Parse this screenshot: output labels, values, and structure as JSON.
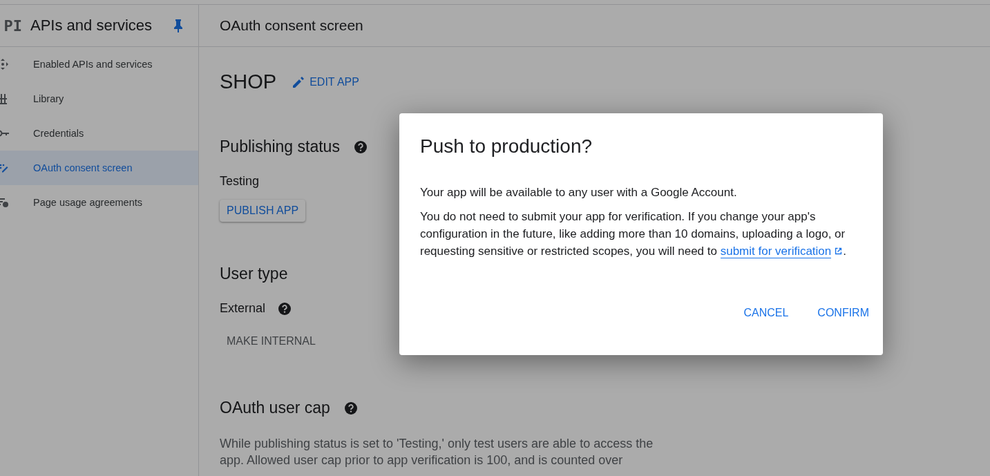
{
  "sidebar": {
    "logo": "PI",
    "title": "APIs and services",
    "items": [
      {
        "label": "Enabled APIs and services",
        "selected": false
      },
      {
        "label": "Library",
        "selected": false
      },
      {
        "label": "Credentials",
        "selected": false
      },
      {
        "label": "OAuth consent screen",
        "selected": true
      },
      {
        "label": "Page usage agreements",
        "selected": false
      }
    ]
  },
  "page": {
    "title": "OAuth consent screen",
    "app_name": "SHOP",
    "edit_button": "EDIT APP",
    "publishing": {
      "heading": "Publishing status",
      "status": "Testing",
      "button": "PUBLISH APP"
    },
    "user_type": {
      "heading": "User type",
      "value": "External",
      "button": "MAKE INTERNAL"
    },
    "user_cap": {
      "heading": "OAuth user cap",
      "text": "While publishing status is set to 'Testing,' only test users are able to access the app. Allowed user cap prior to app verification is 100, and is counted over"
    }
  },
  "dialog": {
    "title": "Push to production?",
    "paragraph_1": "Your app will be available to any user with a Google Account.",
    "paragraph_2": "You do not need to submit your app for verification. If you change your app's configuration in the future, like adding more than 10 domains, uploading a logo, or requesting sensitive or restricted scopes, you will need to",
    "link": "submit for verification",
    "paragraph_end": ".",
    "buttons": [
      "CANCEL",
      "CONFIRM"
    ]
  }
}
